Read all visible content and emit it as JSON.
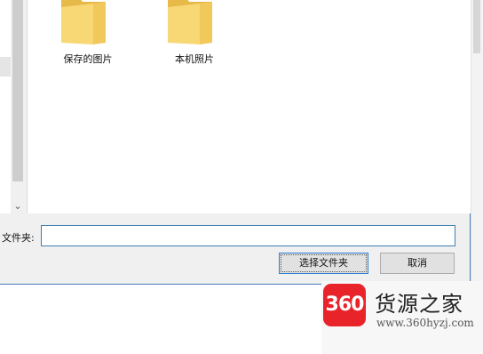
{
  "folders": [
    {
      "label": "保存的图片",
      "icon": "folder-icon"
    },
    {
      "label": "本机照片",
      "icon": "folder-icon"
    }
  ],
  "filename": {
    "label": "文件夹:",
    "value": ""
  },
  "buttons": {
    "select": "选择文件夹",
    "cancel": "取消"
  },
  "nav": {
    "scroll_down": "⌄"
  },
  "watermark": {
    "logo": "360",
    "title": "货源之家",
    "url": "www.360hyzj.com"
  },
  "colors": {
    "folder": "#f8d775",
    "folder_dark": "#e7b949",
    "accent": "#3c7fb1",
    "logo_red": "#e8232a"
  }
}
